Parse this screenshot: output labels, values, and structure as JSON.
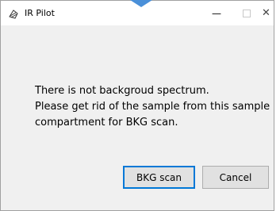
{
  "window": {
    "title": "IR Pilot",
    "controls": {
      "minimize": "—",
      "close": "✕"
    }
  },
  "dialog": {
    "message_lines": [
      "There is not backgroud spectrum.",
      "Please get rid of the sample from this sample",
      "compartment for BKG scan."
    ],
    "buttons": {
      "bkg_scan": "BKG scan",
      "cancel": "Cancel"
    }
  },
  "colors": {
    "accent": "#0078d7",
    "window_bg": "#f0f0f0",
    "titlebar_bg": "#ffffff"
  }
}
